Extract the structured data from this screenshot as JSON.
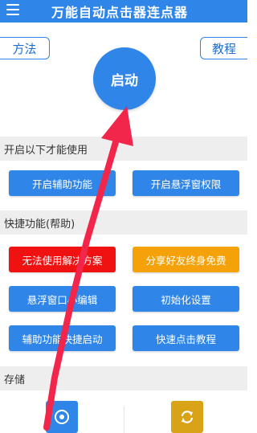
{
  "topbar": {
    "title": "万能自动点击器连点器",
    "menu_icon": "hamburger-menu-icon",
    "color": "#2f86e8"
  },
  "header_buttons": {
    "method": "方法",
    "tutorial": "教程"
  },
  "start_button": {
    "label": "启动"
  },
  "sections": {
    "permissions": {
      "title": "开启以下才能使用",
      "buttons": {
        "accessibility": "开启辅助功能",
        "floating_window": "开启悬浮窗权限"
      }
    },
    "shortcuts": {
      "title": "快捷功能(帮助)",
      "buttons": {
        "cannot_use": "无法使用解决方案",
        "share": "分享好友终身免费",
        "floating_editor": "悬浮窗口小编辑",
        "init_settings": "初始化设置",
        "quick_start": "辅助功能快捷启动",
        "quick_tutorial": "快速点击教程"
      }
    },
    "storage": {
      "title": "存储",
      "tiles": [
        {
          "icon": "target-circle-icon",
          "color": "#2f86e8"
        },
        {
          "icon": "sync-icon",
          "color": "#d9a317"
        }
      ]
    }
  },
  "colors": {
    "primary": "#2f86e8",
    "red": "#f01111",
    "orange": "#f5a20a",
    "arrow": "#f2264a"
  }
}
